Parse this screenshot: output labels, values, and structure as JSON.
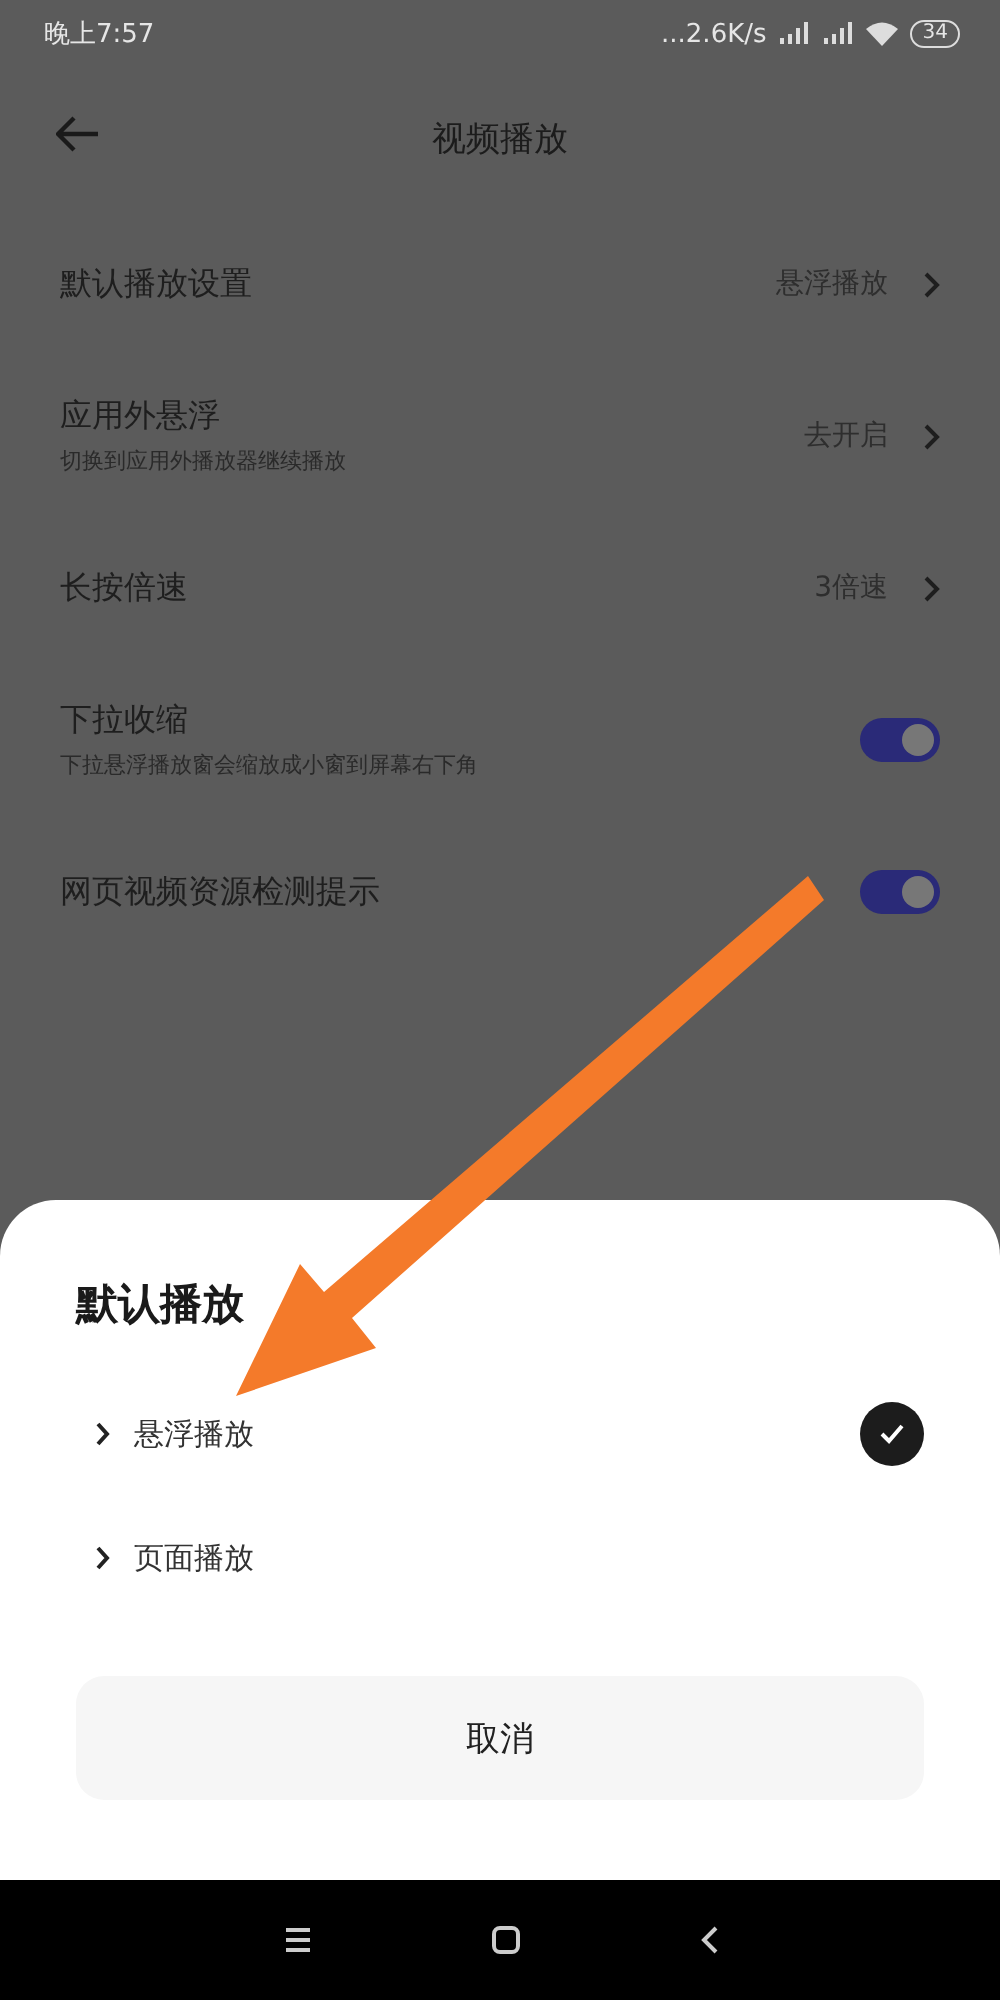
{
  "status_bar": {
    "time": "晚上7:57",
    "speed": "...2.6K/s",
    "battery": "34"
  },
  "header": {
    "title": "视频播放"
  },
  "settings": [
    {
      "kind": "link",
      "label": "默认播放设置",
      "value": "悬浮播放"
    },
    {
      "kind": "link",
      "label": "应用外悬浮",
      "sublabel": "切换到应用外播放器继续播放",
      "value": "去开启"
    },
    {
      "kind": "link",
      "label": "长按倍速",
      "value": "3倍速"
    },
    {
      "kind": "toggle",
      "label": "下拉收缩",
      "sublabel": "下拉悬浮播放窗会缩放成小窗到屏幕右下角",
      "on": true
    },
    {
      "kind": "toggle",
      "label": "网页视频资源检测提示",
      "on": true
    }
  ],
  "sheet": {
    "title": "默认播放",
    "options": [
      {
        "label": "悬浮播放",
        "selected": true
      },
      {
        "label": "页面播放",
        "selected": false
      }
    ],
    "cancel": "取消"
  }
}
